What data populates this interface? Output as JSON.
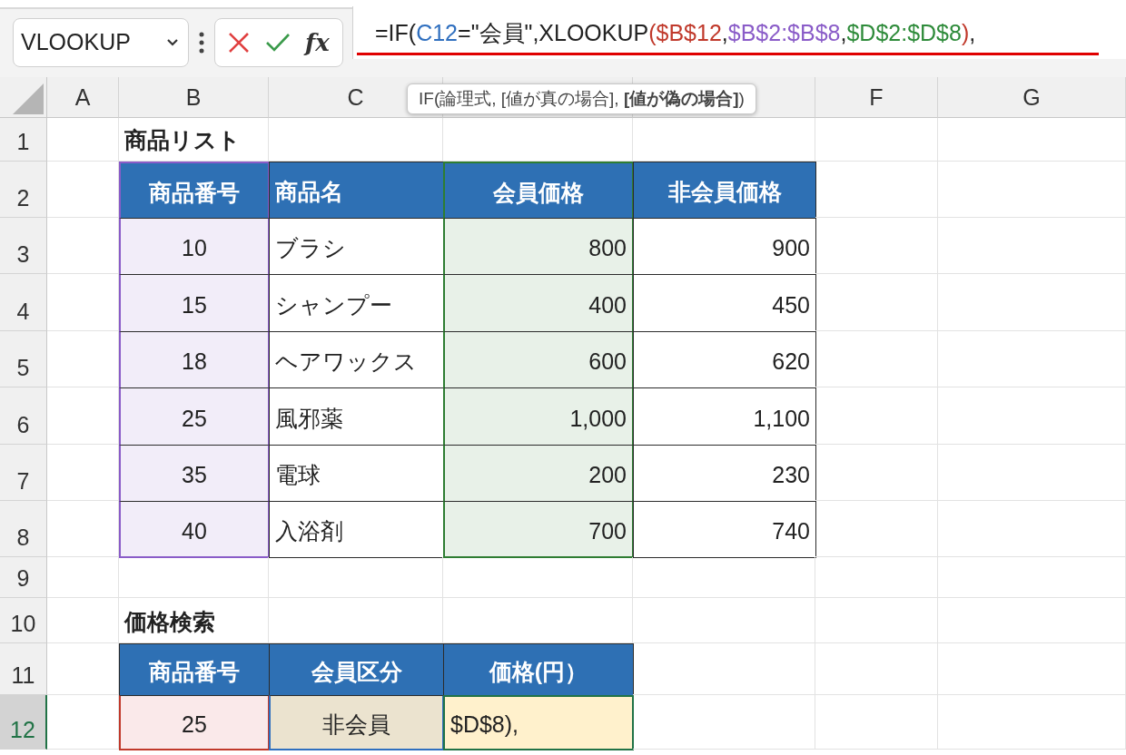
{
  "formula_bar": {
    "name_box": "VLOOKUP",
    "function_button": "fx",
    "segments": [
      {
        "text": "=IF(",
        "color": "#222222"
      },
      {
        "text": "C12",
        "color": "#2f6fbf"
      },
      {
        "text": "=\"会員\",XLOOKUP",
        "color": "#222222"
      },
      {
        "text": "($B$12",
        "color": "#c0392b"
      },
      {
        "text": ",",
        "color": "#222222"
      },
      {
        "text": "$B$2:$B$8",
        "color": "#8a5cc8"
      },
      {
        "text": ",",
        "color": "#222222"
      },
      {
        "text": "$D$2:$D$8",
        "color": "#2e8b3a"
      },
      {
        "text": ")",
        "color": "#c0392b"
      },
      {
        "text": ",",
        "color": "#222222"
      }
    ]
  },
  "tooltip": "IF(論理式, [値が真の場合], **[値が偽の場合]**)",
  "column_headers": [
    "A",
    "B",
    "C",
    "F",
    "G"
  ],
  "row_headers": [
    {
      "label": "1",
      "selected": false
    },
    {
      "label": "2",
      "selected": false
    },
    {
      "label": "3",
      "selected": false
    },
    {
      "label": "4",
      "selected": false
    },
    {
      "label": "5",
      "selected": false
    },
    {
      "label": "6",
      "selected": false
    },
    {
      "label": "7",
      "selected": false
    },
    {
      "label": "8",
      "selected": false
    },
    {
      "label": "9",
      "selected": false
    },
    {
      "label": "10",
      "selected": false
    },
    {
      "label": "11",
      "selected": false
    },
    {
      "label": "12",
      "selected": true
    }
  ],
  "product_list": {
    "title": "商品リスト",
    "columns": [
      "商品番号",
      "商品名",
      "会員価格",
      "非会員価格"
    ],
    "rows": [
      [
        "10",
        "ブラシ",
        "800",
        "900"
      ],
      [
        "15",
        "シャンプー",
        "400",
        "450"
      ],
      [
        "18",
        "ヘアワックス",
        "600",
        "620"
      ],
      [
        "25",
        "風邪薬",
        "1,000",
        "1,100"
      ],
      [
        "35",
        "電球",
        "200",
        "230"
      ],
      [
        "40",
        "入浴剤",
        "700",
        "740"
      ]
    ]
  },
  "price_search": {
    "title": "価格検索",
    "columns": [
      "商品番号",
      "会員区分",
      "価格(円）"
    ],
    "cells": [
      {
        "text": "25",
        "editing": false
      },
      {
        "text": "非会員",
        "editing": false
      },
      {
        "text": "$D$8),",
        "editing": true
      }
    ]
  }
}
